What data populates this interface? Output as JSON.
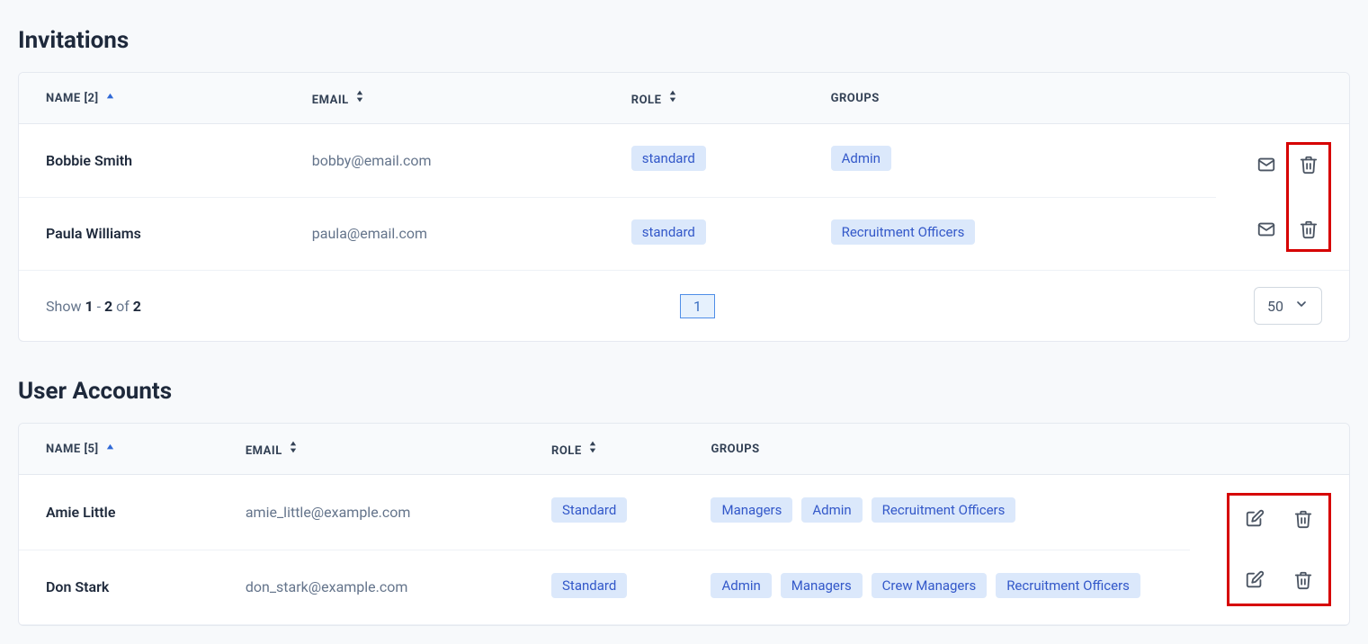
{
  "invitations": {
    "title": "Invitations",
    "columns": {
      "name": "NAME [2]",
      "email": "EMAIL",
      "role": "ROLE",
      "groups": "GROUPS"
    },
    "rows": [
      {
        "name": "Bobbie Smith",
        "email": "bobby@email.com",
        "role": "standard",
        "groups": [
          "Admin"
        ]
      },
      {
        "name": "Paula Williams",
        "email": "paula@email.com",
        "role": "standard",
        "groups": [
          "Recruitment Officers"
        ]
      }
    ],
    "pagination": {
      "show_prefix": "Show ",
      "from": "1",
      "dash": " - ",
      "to": "2",
      "of": " of ",
      "total": "2",
      "current_page": "1",
      "page_size": "50"
    }
  },
  "user_accounts": {
    "title": "User Accounts",
    "columns": {
      "name": "NAME [5]",
      "email": "EMAIL",
      "role": "ROLE",
      "groups": "GROUPS"
    },
    "rows": [
      {
        "name": "Amie Little",
        "email": "amie_little@example.com",
        "role": "Standard",
        "groups": [
          "Managers",
          "Admin",
          "Recruitment Officers"
        ]
      },
      {
        "name": "Don Stark",
        "email": "don_stark@example.com",
        "role": "Standard",
        "groups": [
          "Admin",
          "Managers",
          "Crew Managers",
          "Recruitment Officers"
        ]
      }
    ]
  }
}
